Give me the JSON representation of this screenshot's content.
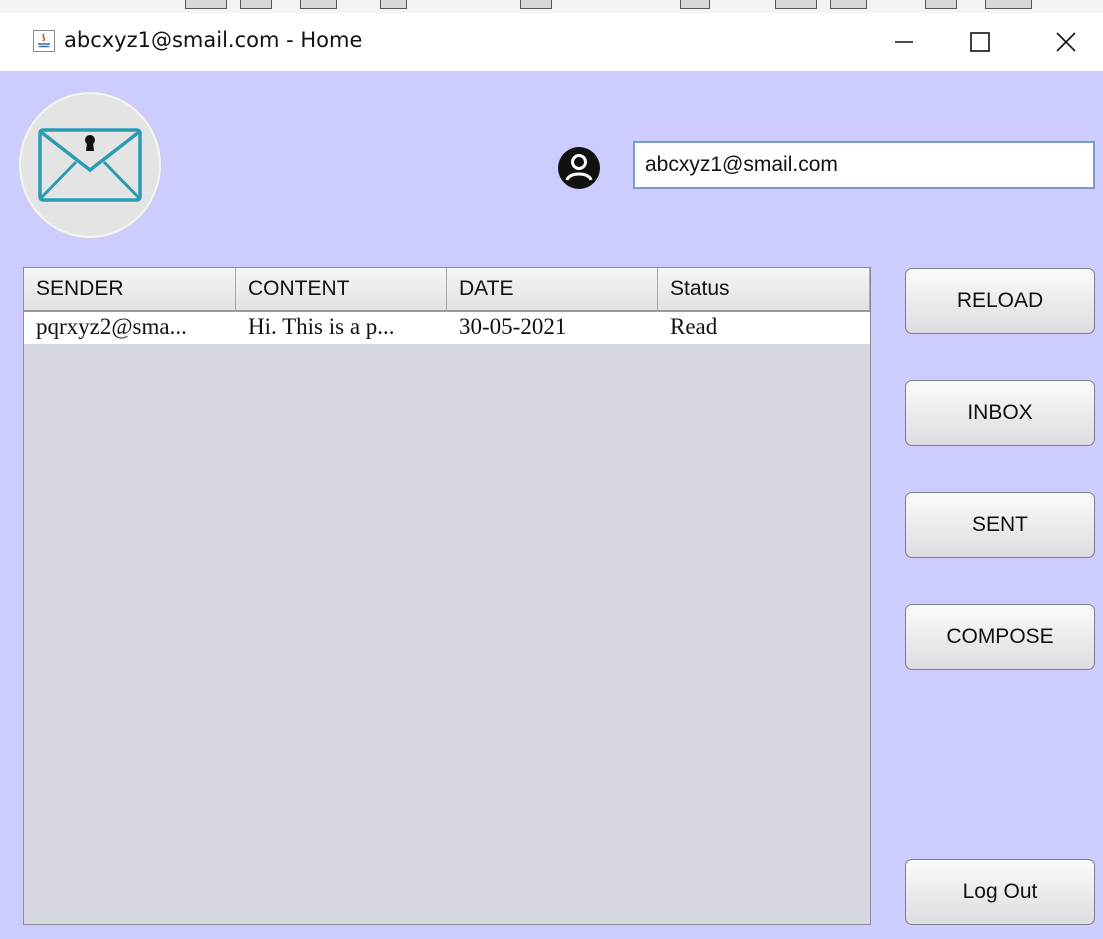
{
  "window": {
    "title": "abcxyz1@smail.com - Home",
    "minimize_glyph": "—",
    "maximize_glyph": "☐",
    "close_glyph": "✕"
  },
  "header": {
    "logo_icon": "envelope-lock-icon",
    "user_icon": "user-circle-icon",
    "email_value": "abcxyz1@smail.com"
  },
  "table": {
    "columns": [
      "SENDER",
      "CONTENT",
      "DATE",
      "Status"
    ],
    "rows": [
      [
        "pqrxyz2@sma...",
        "Hi. This is a p...",
        "30-05-2021",
        "Read"
      ]
    ]
  },
  "buttons": {
    "reload": "RELOAD",
    "inbox": "INBOX",
    "sent": "SENT",
    "compose": "COMPOSE",
    "logout": "Log Out"
  },
  "colors": {
    "panel_background": "#ccccff",
    "table_background": "#d4d7e0",
    "logo_envelope": "#2b9bb5"
  }
}
